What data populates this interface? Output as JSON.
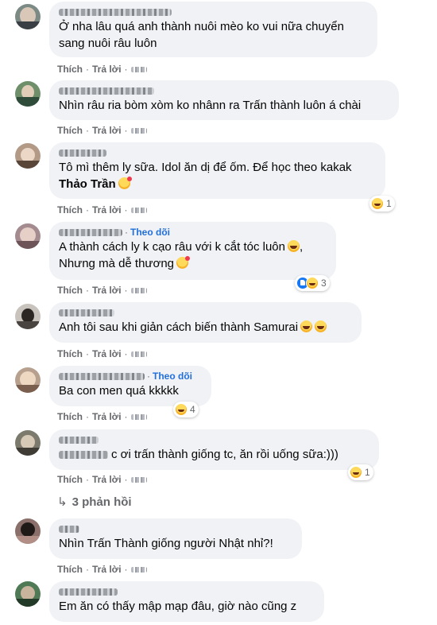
{
  "labels": {
    "like": "Thích",
    "reply": "Trả lời",
    "separator": "·"
  },
  "comments": [
    {
      "lines": [
        "Ở nha lâu quá anh thành nuôi mèo ko vui nữa chuyển",
        "sang nuôi râu luôn"
      ],
      "follow": "",
      "reaction": null
    },
    {
      "lines": [
        "Nhìn râu ria bòm xòm ko nhânn ra Trấn thành luôn á chài"
      ],
      "follow": "",
      "reaction": null
    },
    {
      "lines": [
        "Tô mì thêm ly sữa. Idol ăn dị để ốm. Để học theo kakak"
      ],
      "mention": "Thảo Trần",
      "follow": "",
      "reaction": {
        "icons": [
          "haha-icon"
        ],
        "count": "1"
      }
    },
    {
      "lines": [
        "A thành cách ly k cạo râu với k cắt tóc luôn",
        "Nhưng mà dễ thương"
      ],
      "follow": "Theo dõi",
      "reaction": {
        "icons": [
          "like-icon",
          "haha-icon"
        ],
        "count": "3"
      }
    },
    {
      "lines": [
        "Anh tôi sau khi giản cách biến thành Samurai"
      ],
      "follow": "",
      "reaction": null
    },
    {
      "lines": [
        "Ba con men quá kkkkk"
      ],
      "follow": "Theo dõi",
      "reaction": {
        "icons": [
          "haha-icon"
        ],
        "count": "4"
      }
    },
    {
      "lines": [
        "c ơi trấn thành giống tc, ăn rồi uống sữa:)))"
      ],
      "follow": "",
      "reaction": {
        "icons": [
          "haha-icon"
        ],
        "count": "1"
      }
    },
    {
      "lines": [
        "Nhìn Trấn Thành giống người Nhật nhỉ?!"
      ],
      "follow": "",
      "reaction": null
    },
    {
      "lines": [
        "Em ăn có thấy mập mạp đâu, giờ nào cũng z"
      ],
      "follow": "",
      "reaction": null
    }
  ],
  "replies_link": {
    "arrow": "↳",
    "label": "3 phản hồi"
  },
  "colors": {
    "bubble": "#f0f2f5",
    "link": "#216fdb",
    "meta": "#65676b"
  }
}
